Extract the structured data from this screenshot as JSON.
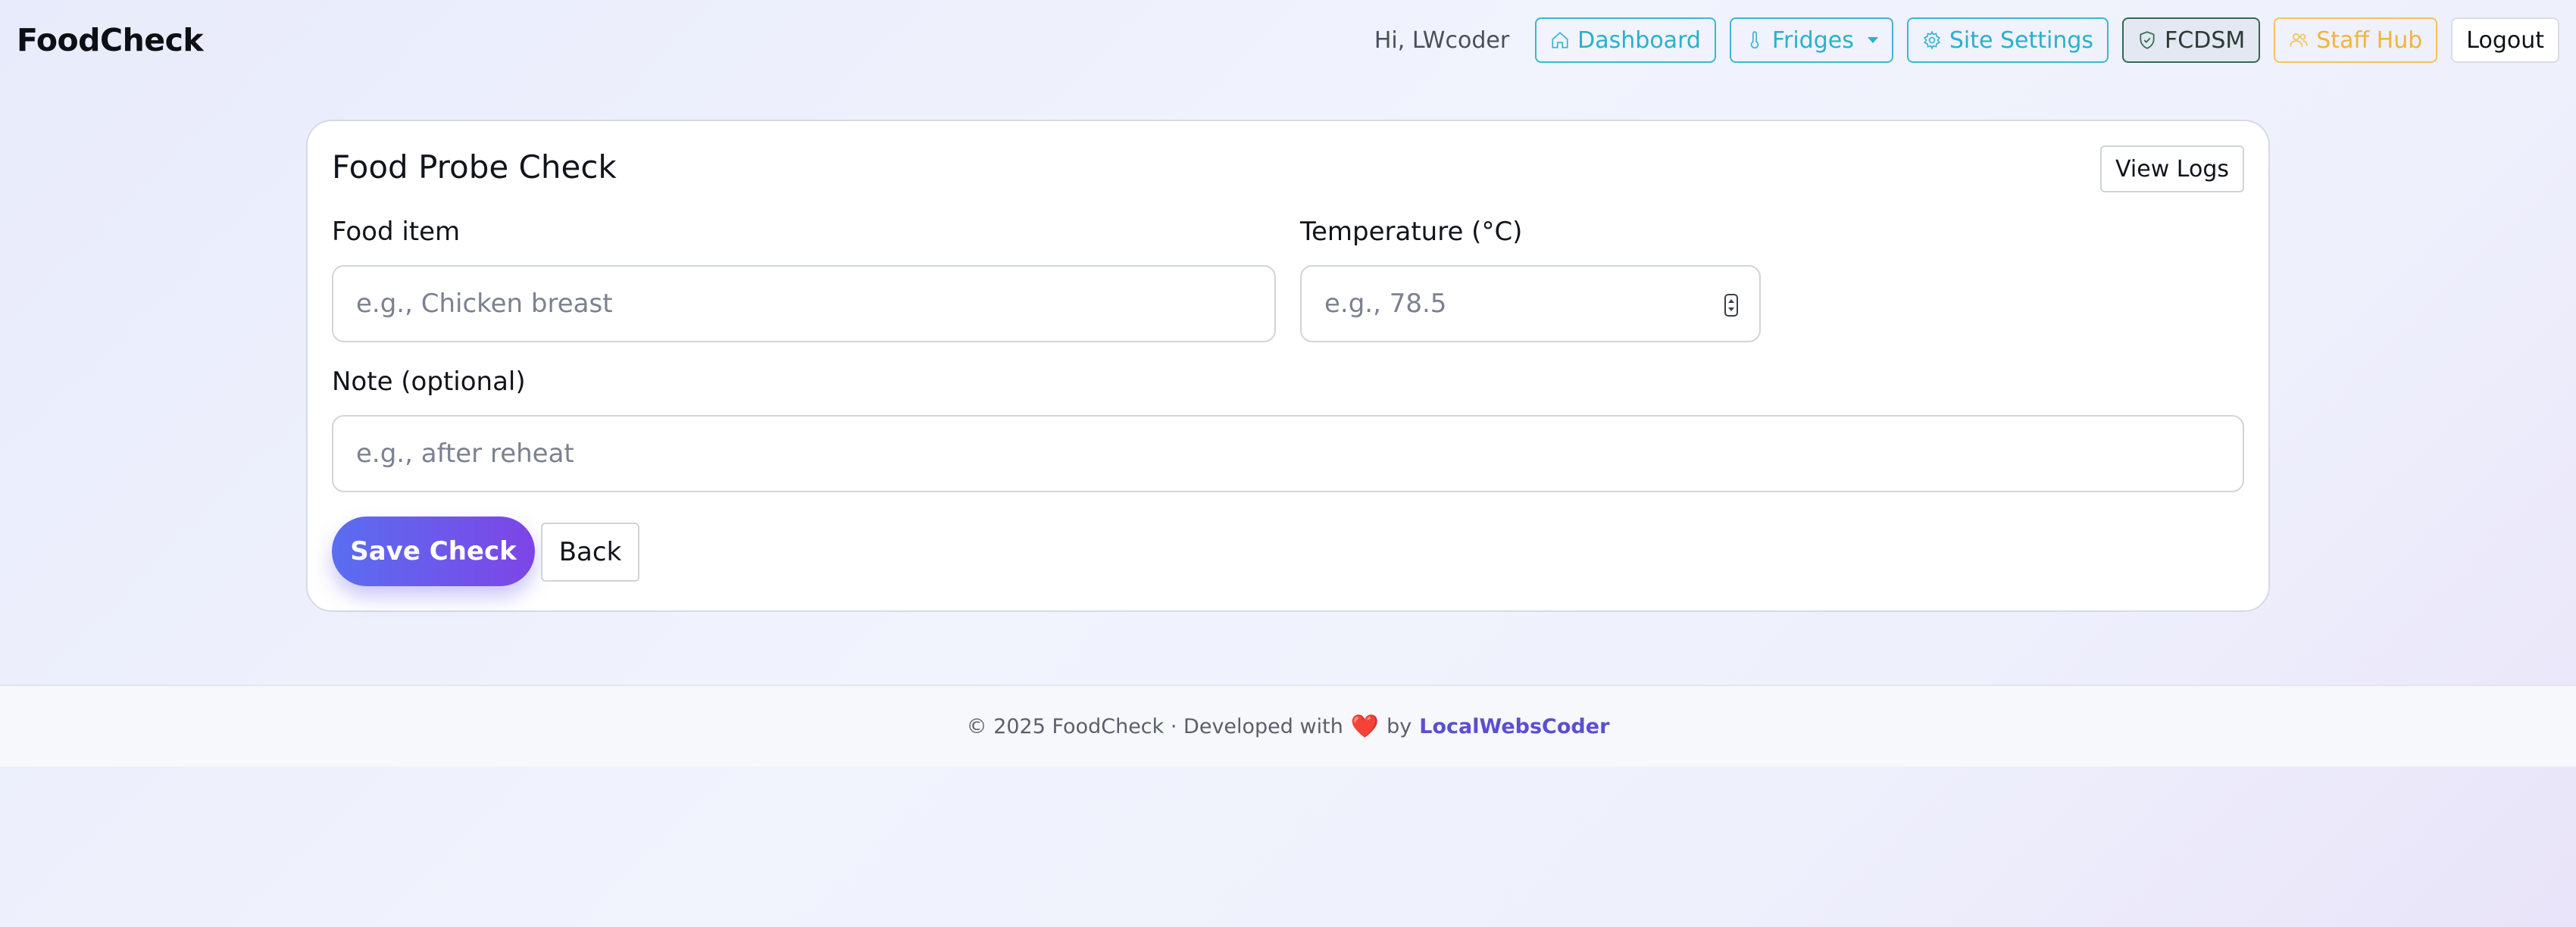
{
  "brand": "FoodCheck",
  "nav": {
    "greeting": "Hi, LWcoder",
    "dashboard": "Dashboard",
    "fridges": "Fridges",
    "site_settings": "Site Settings",
    "fcdsm": "FCDSM",
    "staff_hub": "Staff Hub",
    "logout": "Logout"
  },
  "form": {
    "title": "Food Probe Check",
    "view_logs": "View Logs",
    "food_item_label": "Food item",
    "food_item_placeholder": "e.g., Chicken breast",
    "temperature_label": "Temperature (°C)",
    "temperature_placeholder": "e.g., 78.5",
    "note_label": "Note (optional)",
    "note_placeholder": "e.g., after reheat",
    "save_label": "Save Check",
    "back_label": "Back"
  },
  "footer": {
    "prefix": "© 2025 FoodCheck · Developed with",
    "heart": "❤️",
    "by": "by",
    "developer": "LocalWebsCoder"
  },
  "colors": {
    "accent_gradient_start": "#5a6ef0",
    "accent_gradient_end": "#7d45e6",
    "info": "#2ab0cc",
    "warning": "#f0b53c",
    "success_dark": "#2f6b50"
  }
}
